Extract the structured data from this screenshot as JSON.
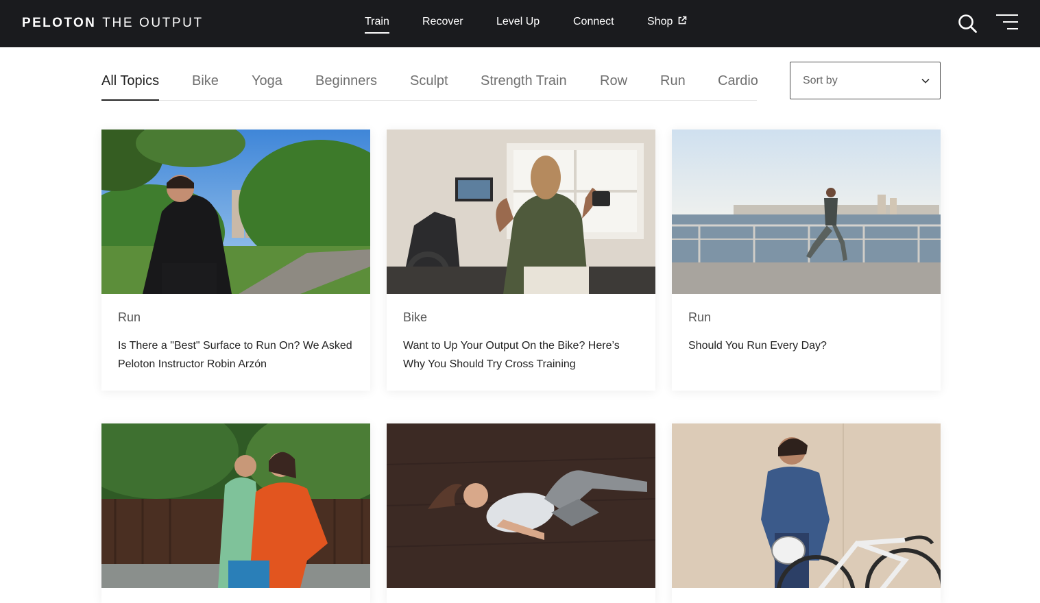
{
  "brand": {
    "primary": "PELOTON",
    "secondary": "THE OUTPUT"
  },
  "nav": {
    "items": [
      {
        "label": "Train",
        "active": true
      },
      {
        "label": "Recover",
        "active": false
      },
      {
        "label": "Level Up",
        "active": false
      },
      {
        "label": "Connect",
        "active": false
      },
      {
        "label": "Shop",
        "active": false,
        "icon": "external-link-icon"
      }
    ],
    "icons": [
      "search-icon",
      "menu-icon"
    ]
  },
  "topics": {
    "items": [
      "All Topics",
      "Bike",
      "Yoga",
      "Beginners",
      "Sculpt",
      "Strength Train",
      "Row",
      "Run",
      "Cardio"
    ],
    "active": "All Topics"
  },
  "sort": {
    "label": "Sort by"
  },
  "articles": [
    {
      "category": "Run",
      "title": "Is There a \"Best\" Surface to Run On? We Asked Peloton Instructor Robin Arzón",
      "image": "woman-running-in-park-photo"
    },
    {
      "category": "Bike",
      "title": "Want to Up Your Output On the Bike? Here’s Why You Should Try Cross Training",
      "image": "woman-lifting-dumbbell-by-bike-photo"
    },
    {
      "category": "Run",
      "title": "Should You Run Every Day?",
      "image": "woman-running-on-waterfront-photo"
    },
    {
      "category": "",
      "title": "",
      "image": "two-women-running-photo"
    },
    {
      "category": "",
      "title": "",
      "image": "woman-stretching-on-floor-photo"
    },
    {
      "category": "",
      "title": "",
      "image": "woman-with-road-bike-photo"
    }
  ],
  "colors": {
    "header_bg": "#1a1b1e",
    "text": "#222222",
    "muted": "#707070"
  }
}
